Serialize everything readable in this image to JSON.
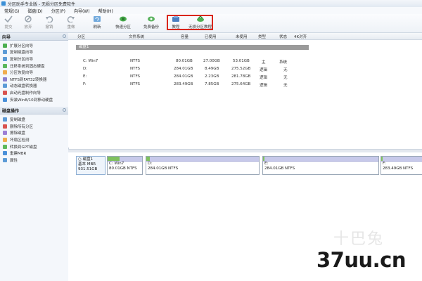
{
  "window": {
    "title": "分区助手专业版 - 无损分区免费软件"
  },
  "menu": [
    "常规(G)",
    "磁盘(D)",
    "分区(P)",
    "向导(W)",
    "帮助(H)"
  ],
  "toolbar": {
    "items": [
      {
        "label": "提交",
        "icon": "check-icon",
        "enabled": false
      },
      {
        "label": "放弃",
        "icon": "discard-icon",
        "enabled": false
      },
      {
        "label": "撤销",
        "icon": "undo-icon",
        "enabled": false
      },
      {
        "label": "重做",
        "icon": "redo-icon",
        "enabled": false
      },
      {
        "label": "刷新",
        "icon": "refresh-icon",
        "enabled": true
      },
      {
        "label": "快速分区",
        "icon": "quick-partition-icon",
        "enabled": true
      },
      {
        "label": "免费备份",
        "icon": "backup-icon",
        "enabled": true
      },
      {
        "label": "教程",
        "icon": "tutorial-icon",
        "enabled": true
      },
      {
        "label": "无损分区教程",
        "icon": "lossless-tutorial-icon",
        "enabled": true
      }
    ],
    "highlight_color": "#d9261c"
  },
  "sidebar": {
    "wizard_title": "向导",
    "wizard_items": [
      "扩展分区向导",
      "复制磁盘向导",
      "复制分区向导",
      "迁移系统到固态硬盘",
      "分区恢复向导",
      "NTFS到FAT32转换器",
      "动态磁盘转换器",
      "启动光盘制作向导",
      "安装Win8/10到移动硬盘"
    ],
    "disk_ops_title": "磁盘操作",
    "disk_ops_items": [
      "复制磁盘",
      "删除所有分区",
      "擦除磁盘",
      "坏扇区检测",
      "转换到GPT磁盘",
      "重建MBR",
      "属性"
    ]
  },
  "columns": [
    "分区",
    "文件系统",
    "容量",
    "已使用",
    "未使用",
    "类型",
    "状态",
    "4K对齐"
  ],
  "disk_group_label": "磁盘1",
  "partitions": [
    {
      "name": "C: Win7",
      "fs": "NTFS",
      "capacity": "80.01GB",
      "used": "27.00GB",
      "free": "53.01GB",
      "type": "主",
      "status": "系统",
      "used_fraction": 0.34
    },
    {
      "name": "D:",
      "fs": "NTFS",
      "capacity": "284.01GB",
      "used": "8.49GB",
      "free": "275.52GB",
      "type": "逻辑",
      "status": "无",
      "used_fraction": 0.03
    },
    {
      "name": "E:",
      "fs": "NTFS",
      "capacity": "284.01GB",
      "used": "2.23GB",
      "free": "281.78GB",
      "type": "逻辑",
      "status": "无",
      "used_fraction": 0.01
    },
    {
      "name": "F:",
      "fs": "NTFS",
      "capacity": "283.49GB",
      "used": "7.85GB",
      "free": "275.64GB",
      "type": "逻辑",
      "status": "无",
      "used_fraction": 0.03
    }
  ],
  "disk_map": {
    "disk_name": "磁盘1",
    "disk_type": "基本 MBR",
    "disk_size": "931.51GB",
    "blocks": [
      {
        "name": "C: Win7",
        "info": "80.01GB NTFS"
      },
      {
        "name": "D:",
        "info": "284.01GB NTFS"
      },
      {
        "name": "E:",
        "info": "284.01GB NTFS"
      },
      {
        "name": "F:",
        "info": "283.49GB NTFS"
      }
    ]
  },
  "watermark": {
    "main": "37uu.cn",
    "ghost": "十巴兔"
  }
}
